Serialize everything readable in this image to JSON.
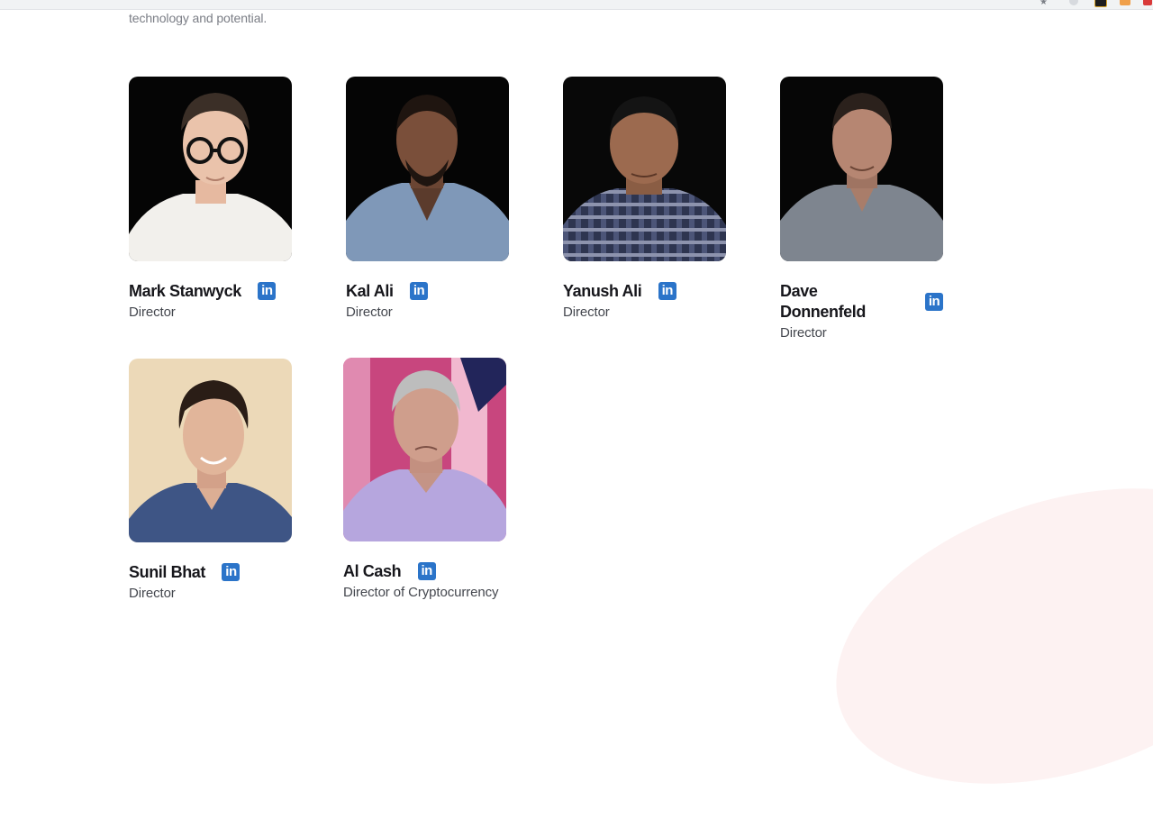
{
  "page": {
    "intro_text": "technology and potential."
  },
  "team": [
    {
      "name": "Mark Stanwyck",
      "role": "Director"
    },
    {
      "name": "Kal Ali",
      "role": "Director"
    },
    {
      "name": "Yanush Ali",
      "role": "Director"
    },
    {
      "name": "Dave Donnenfeld",
      "role": "Director"
    },
    {
      "name": "Sunil Bhat",
      "role": "Director"
    },
    {
      "name": "Al Cash",
      "role": "Director of Cryptocurrency"
    }
  ],
  "icons": {
    "linkedin": "linkedin-icon"
  },
  "colors": {
    "linkedin_blue": "#2b74c9",
    "name_text": "#17171c",
    "role_text": "#44474e"
  }
}
